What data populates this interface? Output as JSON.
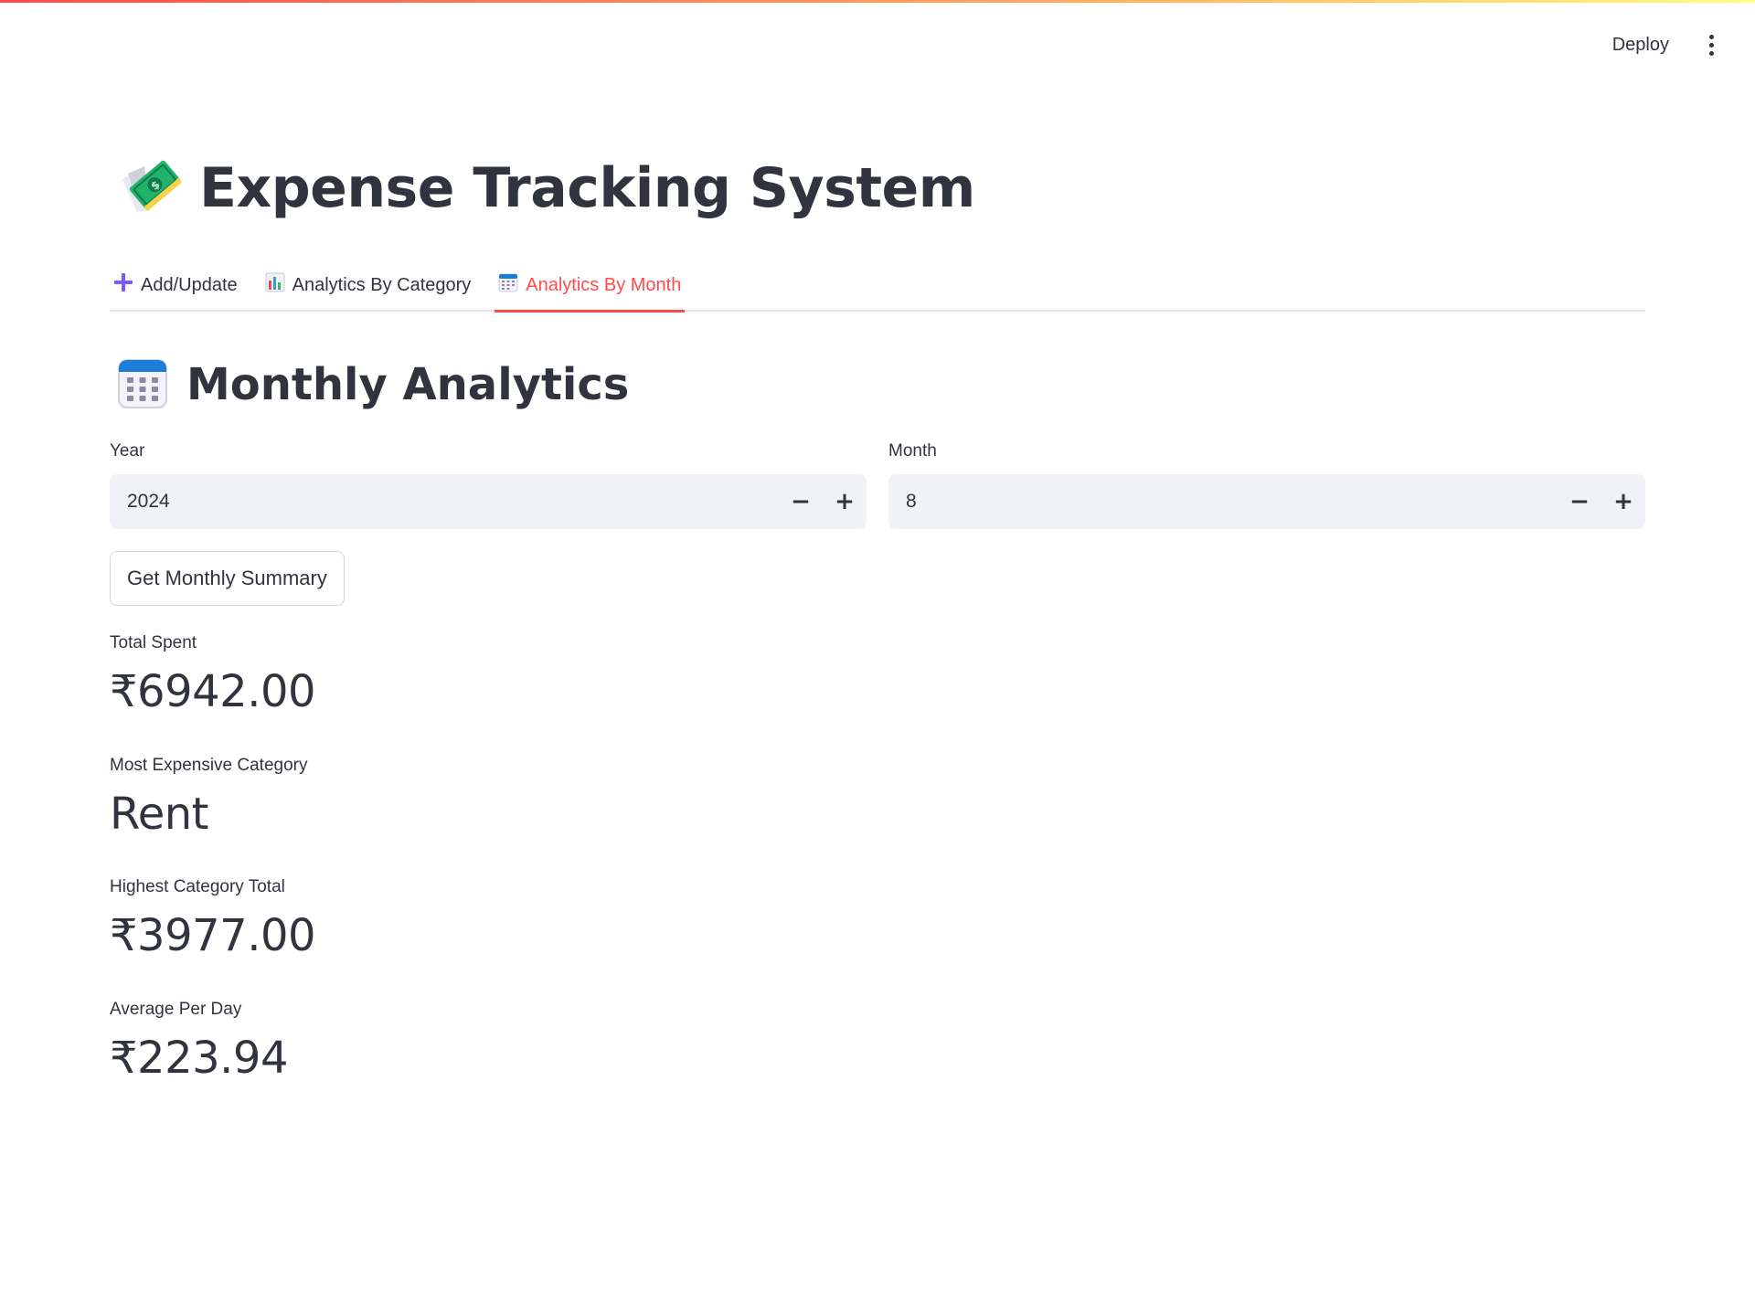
{
  "header": {
    "deploy_label": "Deploy",
    "menu_icon": "kebab-menu-icon"
  },
  "app": {
    "title": "Expense Tracking System",
    "title_icon": "money-with-wings-icon"
  },
  "tabs": [
    {
      "label": "Add/Update",
      "icon": "plus-icon"
    },
    {
      "label": "Analytics By Category",
      "icon": "bar-chart-icon"
    },
    {
      "label": "Analytics By Month",
      "icon": "calendar-icon",
      "active": true
    }
  ],
  "section": {
    "title": "Monthly Analytics",
    "icon": "calendar-icon"
  },
  "inputs": {
    "year": {
      "label": "Year",
      "value": "2024"
    },
    "month": {
      "label": "Month",
      "value": "8"
    }
  },
  "button": {
    "label": "Get Monthly Summary"
  },
  "metrics": [
    {
      "label": "Total Spent",
      "value": "₹6942.00"
    },
    {
      "label": "Most Expensive Category",
      "value": "Rent"
    },
    {
      "label": "Highest Category Total",
      "value": "₹3977.00"
    },
    {
      "label": "Average Per Day",
      "value": "₹223.94"
    }
  ],
  "colors": {
    "accent": "#ff4b4b",
    "text": "#31333f",
    "input_bg": "#f0f2f6",
    "plus_icon": "#7a5af8"
  }
}
